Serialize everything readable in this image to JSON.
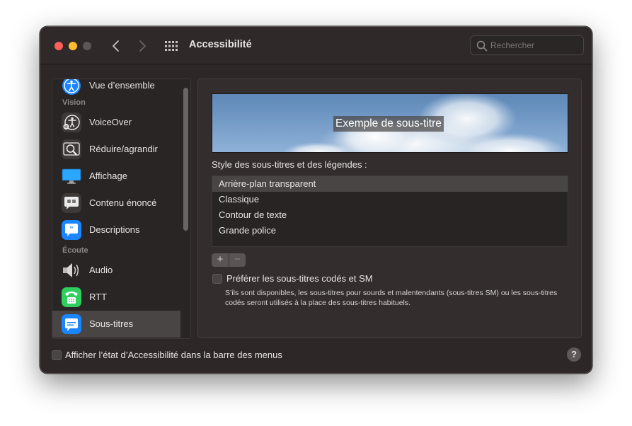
{
  "window": {
    "title": "Accessibilité"
  },
  "search": {
    "placeholder": "Rechercher"
  },
  "sidebar": {
    "items": [
      {
        "label": "Vue d’ensemble",
        "icon": "accessibility-icon"
      },
      {
        "label": "VoiceOver",
        "icon": "voiceover-icon"
      },
      {
        "label": "Réduire/agrandir",
        "icon": "zoom-icon"
      },
      {
        "label": "Affichage",
        "icon": "display-icon"
      },
      {
        "label": "Contenu énoncé",
        "icon": "spoken-content-icon"
      },
      {
        "label": "Descriptions",
        "icon": "descriptions-icon"
      },
      {
        "label": "Audio",
        "icon": "speaker-icon"
      },
      {
        "label": "RTT",
        "icon": "rtt-phone-icon"
      },
      {
        "label": "Sous-titres",
        "icon": "captions-icon",
        "selected": true
      }
    ],
    "sections": {
      "vision": "Vision",
      "ecoute": "Écoute"
    }
  },
  "main": {
    "preview_text": "Exemple de sous-titre",
    "style_label": "Style des sous-titres et des légendes :",
    "styles": [
      {
        "label": "Arrière-plan transparent",
        "selected": true
      },
      {
        "label": "Classique"
      },
      {
        "label": "Contour de texte"
      },
      {
        "label": "Grande police"
      }
    ],
    "add_label": "+",
    "remove_label": "−",
    "prefer_checkbox": {
      "label": "Préférer les sous-titres codés et SM",
      "checked": false,
      "description": "S’ils sont disponibles, les sous-titres pour sourds et malentendants (sous-titres SM) ou les sous-titres codés seront utilisés à la place des sous-titres habituels."
    }
  },
  "footer": {
    "menubar_checkbox": {
      "label": "Afficher l’état d’Accessibilité dans la barre des menus",
      "checked": false
    },
    "help_label": "?"
  },
  "colors": {
    "window_bg": "#2d2827",
    "selection": "#4a4545",
    "close": "#fe5f57",
    "minimize": "#febc2e",
    "icon_blue": "#1a85ff",
    "icon_green": "#2ecf5e"
  }
}
